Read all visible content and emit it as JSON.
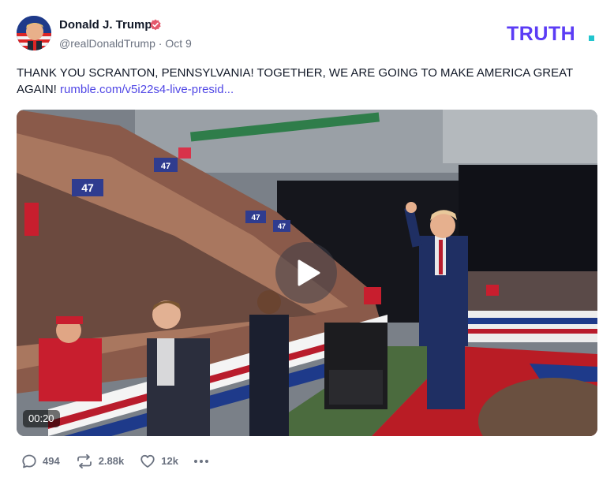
{
  "author": {
    "display_name": "Donald J. Trump",
    "handle": "@realDonaldTrump",
    "separator": " · ",
    "date": "Oct 9",
    "verified": true
  },
  "brand": {
    "logo_text": "TRUTH.",
    "logo_color": "#5b3cf5",
    "logo_accent": "#22c5ce"
  },
  "post": {
    "text": "THANK YOU SCRANTON, PENNSYLVANIA! TOGETHER, WE ARE GOING TO MAKE AMERICA GREAT AGAIN!",
    "link_text": "rumble.com/v5i22s4-live-presid..."
  },
  "video": {
    "duration": "00:20",
    "sign_text": "47"
  },
  "actions": {
    "replies": "494",
    "reposts": "2.88k",
    "likes": "12k"
  },
  "colors": {
    "verified_badge": "#e4586b",
    "link": "#4f46e5",
    "muted_text": "#6b7280"
  }
}
